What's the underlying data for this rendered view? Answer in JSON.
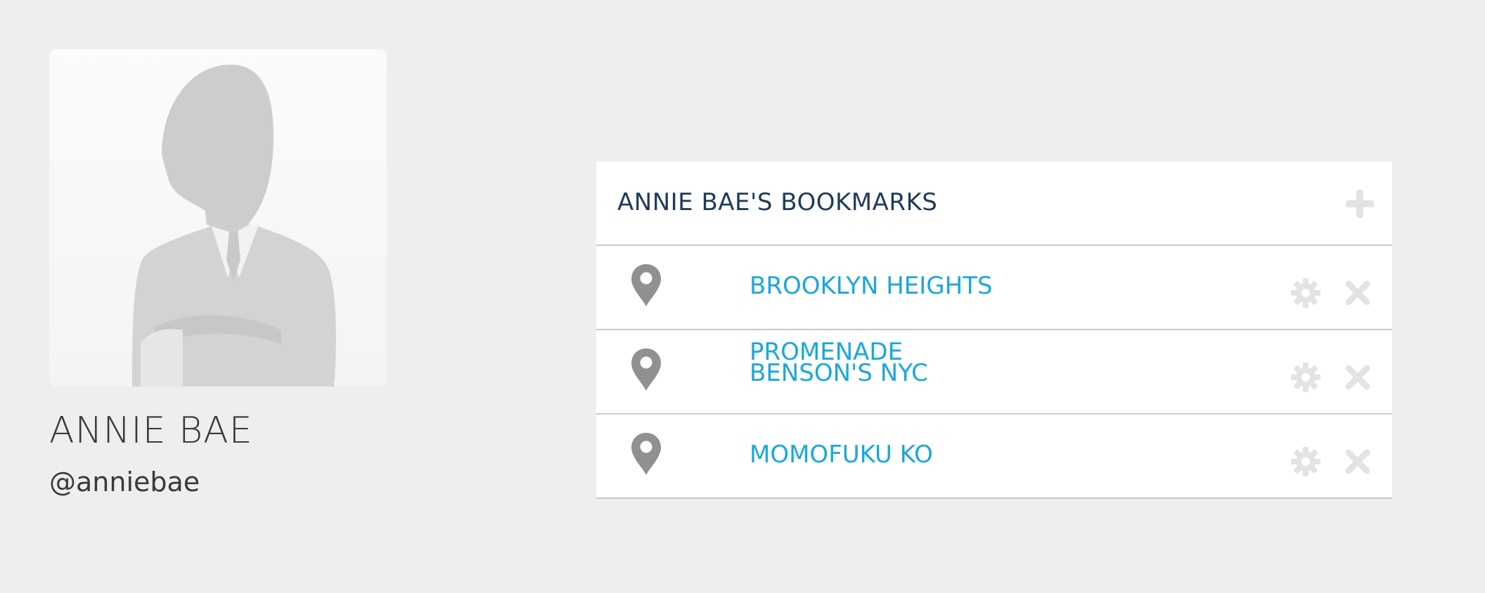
{
  "profile": {
    "name": "ANNIE BAE",
    "handle": "@anniebae",
    "avatar_icon": "person-silhouette-icon"
  },
  "bookmarks_panel": {
    "title": "ANNIE BAE'S BOOKMARKS",
    "add_icon": "plus-icon",
    "items": [
      {
        "label_lines": [
          "BROOKLYN HEIGHTS"
        ],
        "icon": "map-pin-icon"
      },
      {
        "label_lines": [
          "PROMENADE",
          "BENSON'S NYC"
        ],
        "icon": "map-pin-icon"
      },
      {
        "label_lines": [
          "MOMOFUKU KO"
        ],
        "icon": "map-pin-icon"
      }
    ],
    "row_action_icons": [
      "gear-icon",
      "close-icon"
    ]
  },
  "colors": {
    "background": "#eeeeee",
    "panel": "#ffffff",
    "title": "#1f3b5a",
    "link": "#1aa7dc",
    "pin": "#909090",
    "muted_icon": "#e3e3e3",
    "divider": "#c9c9c9",
    "text_dark": "#3a3a3a"
  }
}
